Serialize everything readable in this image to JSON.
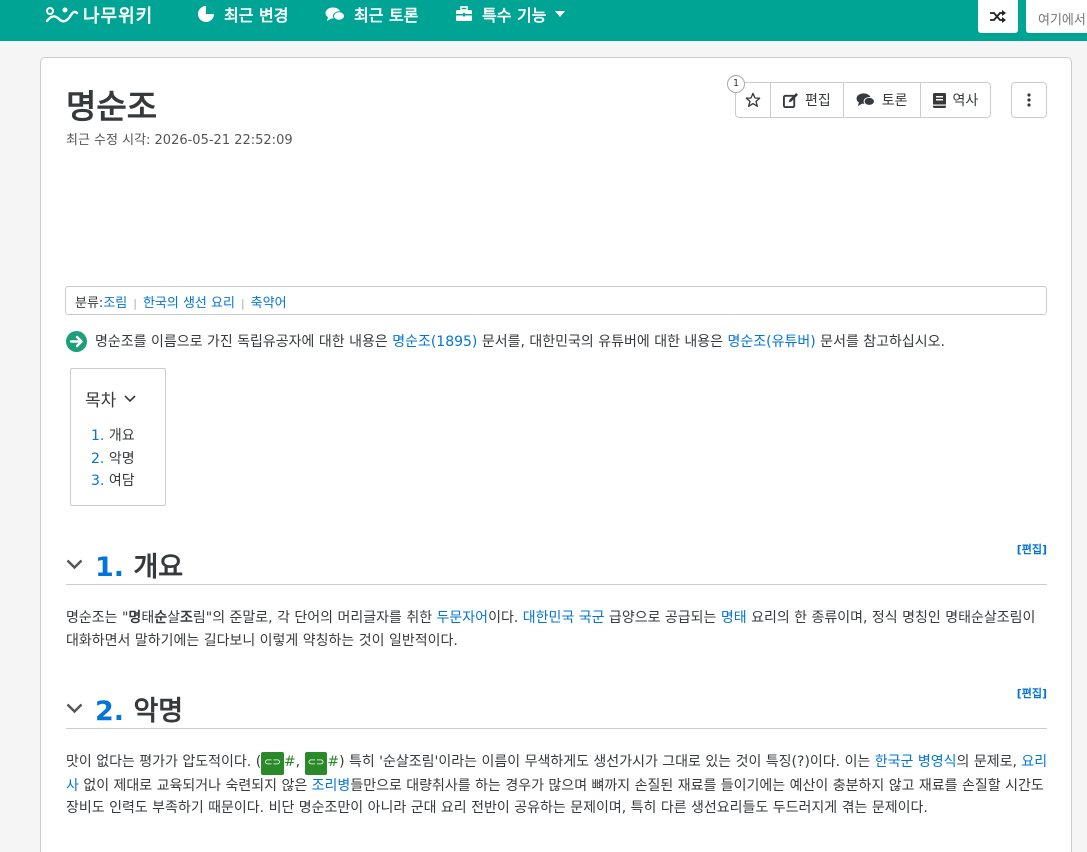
{
  "nav": {
    "logo": "나무위키",
    "recent_changes": "최근 변경",
    "recent_discuss": "최근 토론",
    "special": "특수 기능",
    "search_placeholder": "여기에서 검색"
  },
  "article": {
    "title": "명순조",
    "last_modified": "최근 수정 시각: 2026-05-21 22:52:09",
    "star_count": "1",
    "actions": {
      "edit": "편집",
      "discuss": "토론",
      "history": "역사"
    }
  },
  "category": {
    "label": "분류:",
    "items": [
      "조림",
      "한국의 생선 요리",
      "축약어"
    ]
  },
  "notice": {
    "text1": "명순조를 이름으로 가진 독립유공자에 대한 내용은 ",
    "link1": "명순조(1895)",
    "text2": " 문서를, 대한민국의 유튜버에 대한 내용은 ",
    "link2": "명순조(유튜버)",
    "text3": " 문서를 참고하십시오."
  },
  "toc": {
    "title": "목차",
    "items": [
      {
        "num": "1.",
        "label": "개요"
      },
      {
        "num": "2.",
        "label": "악명"
      },
      {
        "num": "3.",
        "label": "여담"
      }
    ]
  },
  "sections": [
    {
      "num": "1.",
      "title": "개요",
      "edit": "[편집]"
    },
    {
      "num": "2.",
      "title": "악명",
      "edit": "[편집]"
    }
  ],
  "p1": {
    "t1": "명순조는 \"",
    "b1": "명",
    "t2": "태",
    "b2": "순",
    "t3": "살",
    "b3": "조",
    "t4": "림\"의 준말로, 각 단어의 머리글자를 취한 ",
    "l1": "두문자어",
    "t5": "이다. ",
    "l2": "대한민국 국군",
    "t6": " 급양으로 공급되는 ",
    "l3": "명태",
    "t7": " 요리의 한 종류이며, 정식 명칭인 명태순살조림이 대화하면서 말하기에는 길다보니 이렇게 약칭하는 것이 일반적이다."
  },
  "p2": {
    "t1": "맛이 없다는 평가가 압도적이다. (",
    "hash1": "#",
    "sep": ", ",
    "hash2": "#",
    "t2": ") 특히 '순살조림'이라는 이름이 무색하게도 생선가시가 그대로 있는 것이 특징(?)이다. 이는 ",
    "l1": "한국군 병영식",
    "t3": "의 문제로, ",
    "l2": "요리사",
    "t4": " 없이 제대로 교육되거나 숙련되지 않은 ",
    "l3": "조리병",
    "t5": "들만으로 대량취사를 하는 경우가 많으며 뼈까지 손질된 재료를 들이기에는 예산이 충분하지 않고 재료를 손질할 시간도 장비도 인력도 부족하기 때문이다. 비단 명순조만이 아니라 군대 요리 전반이 공유하는 문제이며, 특히 다른 생선요리들도 두드러지게 겪는 문제이다."
  },
  "colors": {
    "brand": "#00a495",
    "link": "#0275d8"
  }
}
